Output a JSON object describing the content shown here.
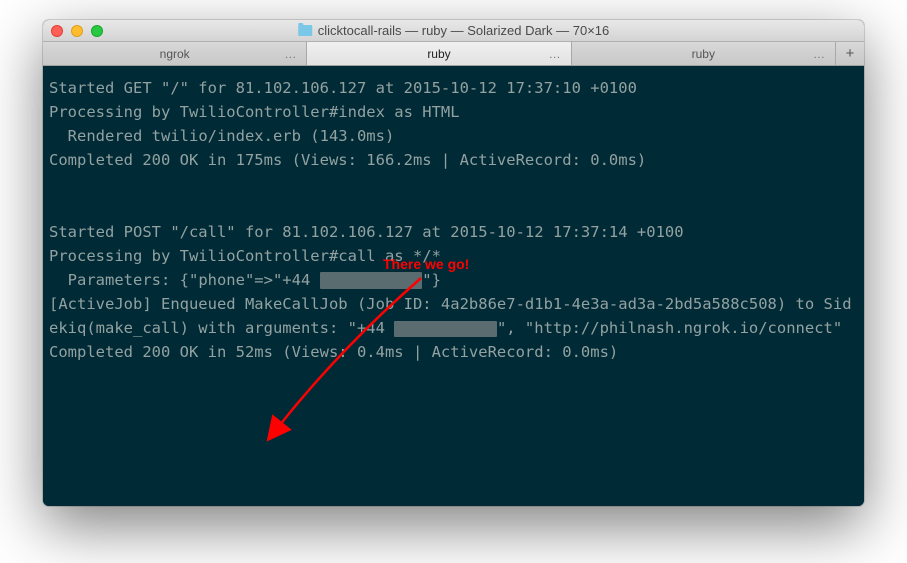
{
  "window": {
    "title": "clicktocall-rails — ruby — Solarized Dark — 70×16"
  },
  "tabs": [
    {
      "label": "ngrok",
      "active": false
    },
    {
      "label": "ruby",
      "active": true
    },
    {
      "label": "ruby",
      "active": false
    }
  ],
  "log": {
    "line1": "Started GET \"/\" for 81.102.106.127 at 2015-10-12 17:37:10 +0100",
    "line2": "Processing by TwilioController#index as HTML",
    "line3": "  Rendered twilio/index.erb (143.0ms)",
    "line4": "Completed 200 OK in 175ms (Views: 166.2ms | ActiveRecord: 0.0ms)",
    "blank1": "",
    "blank2": "",
    "line5": "Started POST \"/call\" for 81.102.106.127 at 2015-10-12 17:37:14 +0100",
    "line6": "Processing by TwilioController#call as */*",
    "line7a": "  Parameters: {\"phone\"=>\"+44 ",
    "line7b": "\"}",
    "line8a": "[ActiveJob] Enqueued MakeCallJob (Job ID: 4a2b86e7-d1b1-4e3a-ad3a-2bd5a588c508) to Sidekiq(make_call) with arguments: \"+44 ",
    "line8b": "\", \"http://philnash.ngrok.io/connect\"",
    "line9": "Completed 200 OK in 52ms (Views: 0.4ms | ActiveRecord: 0.0ms)"
  },
  "annotation": {
    "text": "There we go!"
  }
}
